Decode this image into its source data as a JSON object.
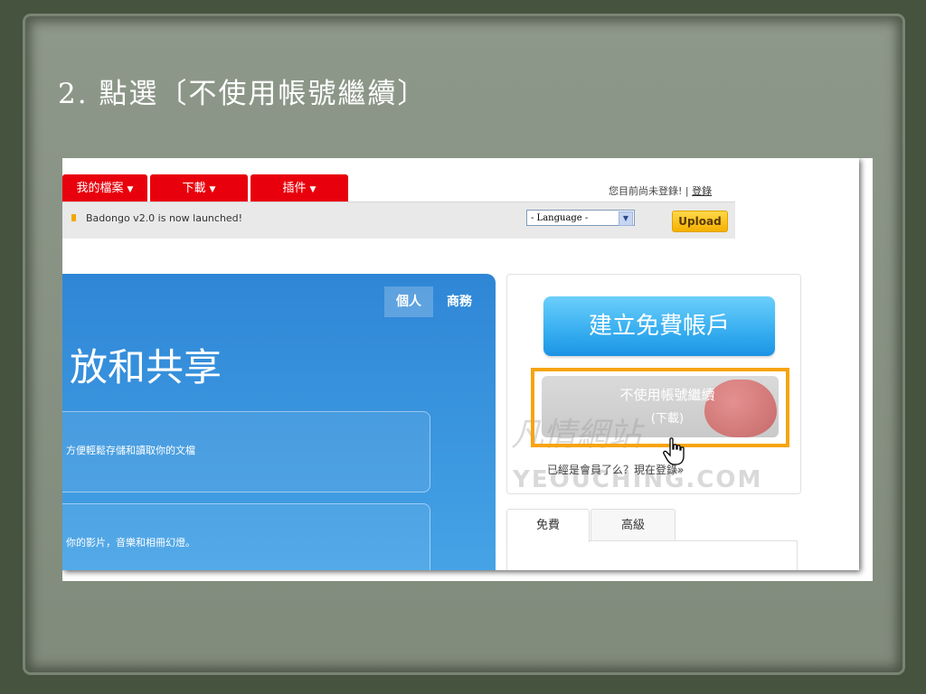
{
  "slide": {
    "title": "2. 點選〔不使用帳號繼續〕"
  },
  "site": {
    "tabs": [
      {
        "label": "我的檔案"
      },
      {
        "label": "下載"
      },
      {
        "label": "插件"
      }
    ],
    "tab_caret": "▼",
    "login_status": "您目前尚未登錄! |",
    "login_link": "登錄",
    "news": "Badongo v2.0 is now launched!",
    "language_select": "- Language -",
    "upload_button": "Upload",
    "hero": {
      "tabs": [
        "個人",
        "商務"
      ],
      "headline": "放和共享",
      "feature_1": "方便輕鬆存儲和讀取你的文檔",
      "feature_2": "你的影片，音樂和相冊幻燈。"
    },
    "panel": {
      "create_button": "建立免費帳戶",
      "guest_button": "不使用帳號繼續",
      "guest_button_sub": "(下載)",
      "member_text": "已經是會員了么？現在登錄»",
      "watermark_cn": "凡情網站",
      "watermark_url": "YEOUCHING.COM"
    },
    "bottom_tabs": [
      "免費",
      "高級"
    ]
  },
  "colors": {
    "tab_red": "#e8000c",
    "highlight_orange": "#f7a40e",
    "create_blue": "#3ab0f1",
    "upload_yellow": "#f5b000"
  }
}
